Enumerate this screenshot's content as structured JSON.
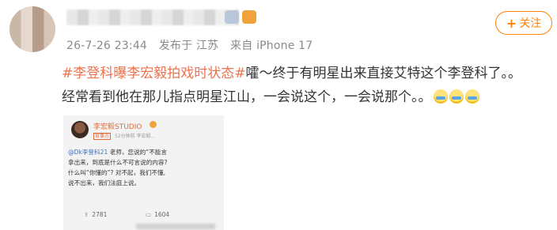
{
  "header": {
    "meta_date": "26-7-26 23:44",
    "meta_from": "发布于 江苏",
    "meta_device": "来自 iPhone 17",
    "follow_label": "关注",
    "follow_icon": "plus-icon"
  },
  "post": {
    "hashtag": "#李登科曝李宏毅拍戏时状态#",
    "text_line1": "嚯～终于有明星出来直接艾特这个李登科了。。",
    "text_line2": "经常看到他在那儿指点明星江山，一会说这个，一会说那个。。"
  },
  "embedded_post": {
    "author": "李宏毅STUDIO",
    "badge": "官事方",
    "time": "52分钟前",
    "source": "李宏毅...",
    "mention": "@Dk李登科21",
    "line1_rest": " 老师，您说的“不能言",
    "line2": "拿出来，到底是什么不可言说的内容?",
    "line3": "什么叫“你懂的”? 对不起，我们不懂,",
    "line4": "说不出来，我们法庭上说。",
    "shares": "2781",
    "comments": "1604"
  }
}
